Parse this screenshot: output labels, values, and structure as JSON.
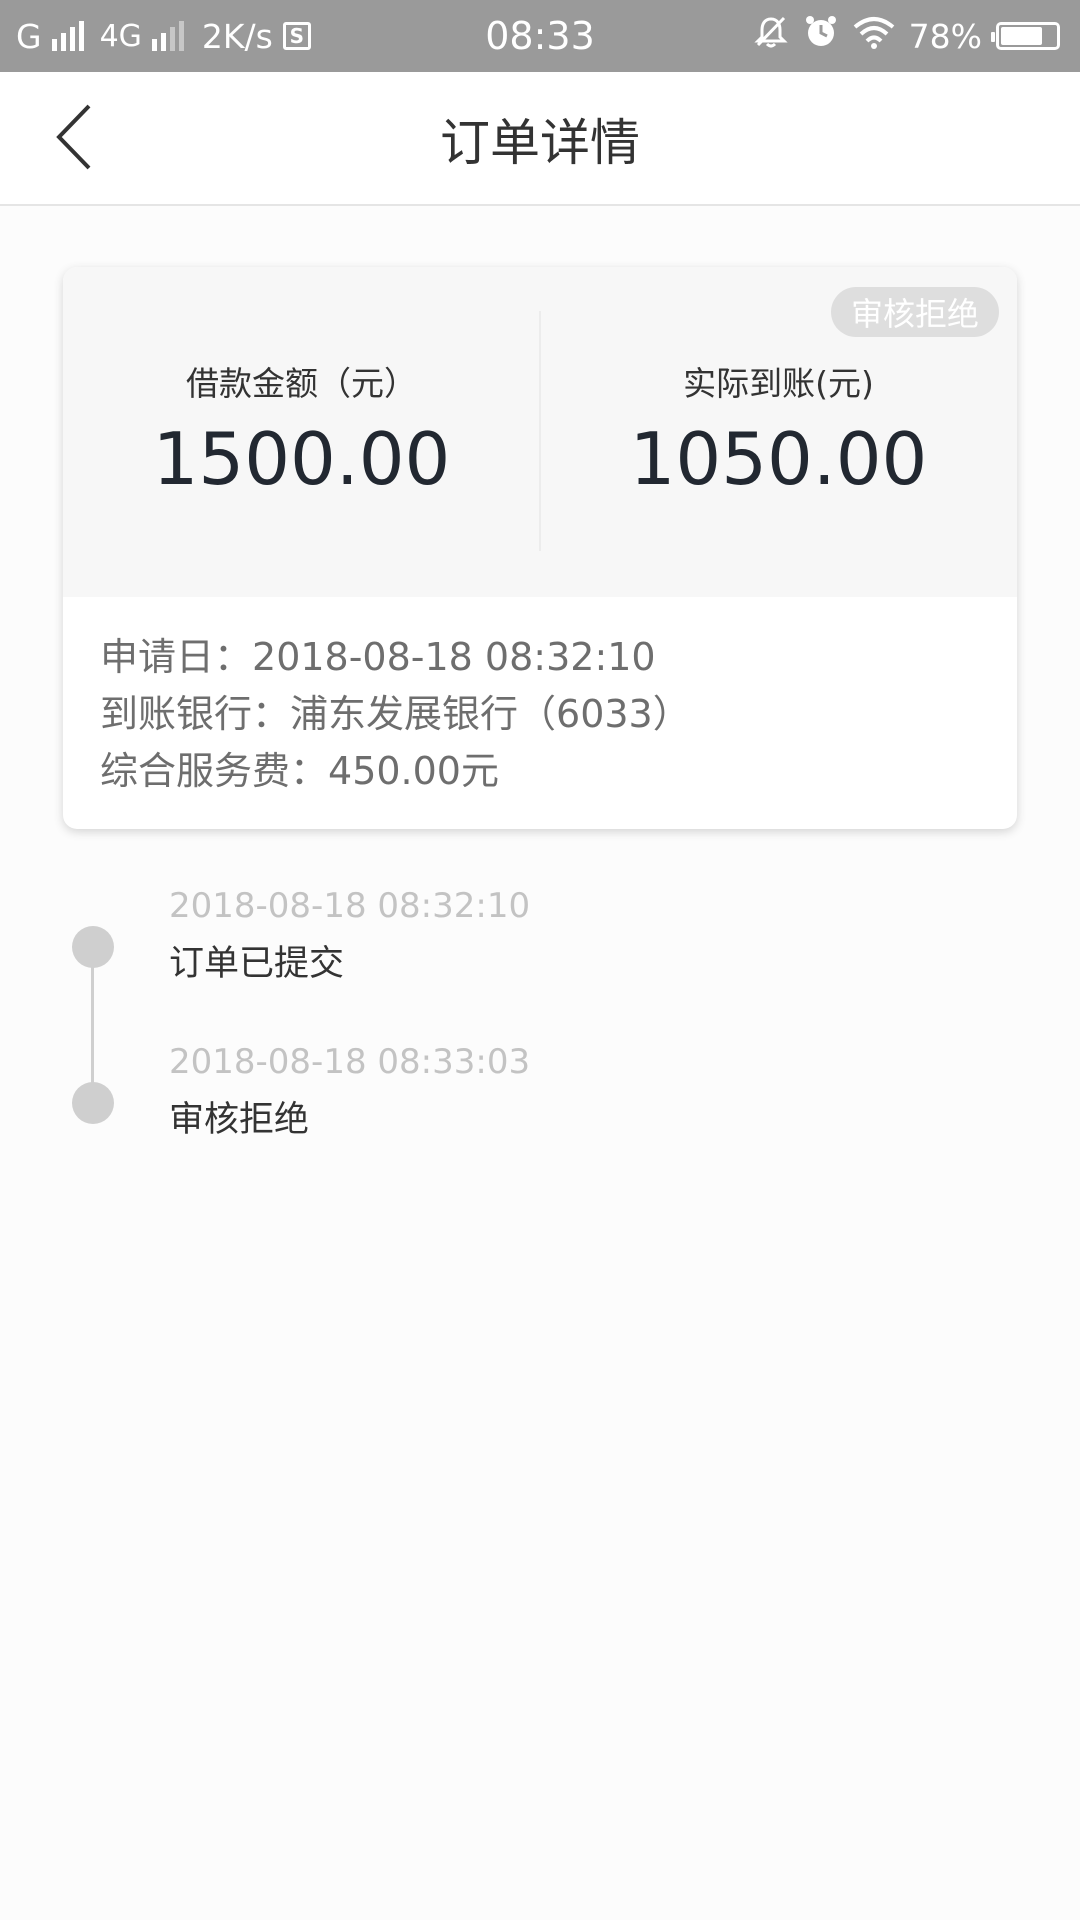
{
  "status_bar": {
    "carrier": "G",
    "network": "4G",
    "speed": "2K/s",
    "speed_icon": "S",
    "time": "08:33",
    "battery": "78%",
    "battery_level_percent": 78
  },
  "nav": {
    "title": "订单详情"
  },
  "order": {
    "status_badge": "审核拒绝",
    "loan_amount_label": "借款金额（元）",
    "loan_amount": "1500.00",
    "actual_amount_label": "实际到账(元)",
    "actual_amount": "1050.00",
    "details": [
      {
        "label": "申请日：",
        "value": "2018-08-18 08:32:10"
      },
      {
        "label": "到账银行：",
        "value": "浦东发展银行（6033）"
      },
      {
        "label": "综合服务费：",
        "value": "450.00元"
      }
    ]
  },
  "timeline": [
    {
      "time": "2018-08-18 08:32:10",
      "event": "订单已提交"
    },
    {
      "time": "2018-08-18 08:33:03",
      "event": "审核拒绝"
    }
  ]
}
